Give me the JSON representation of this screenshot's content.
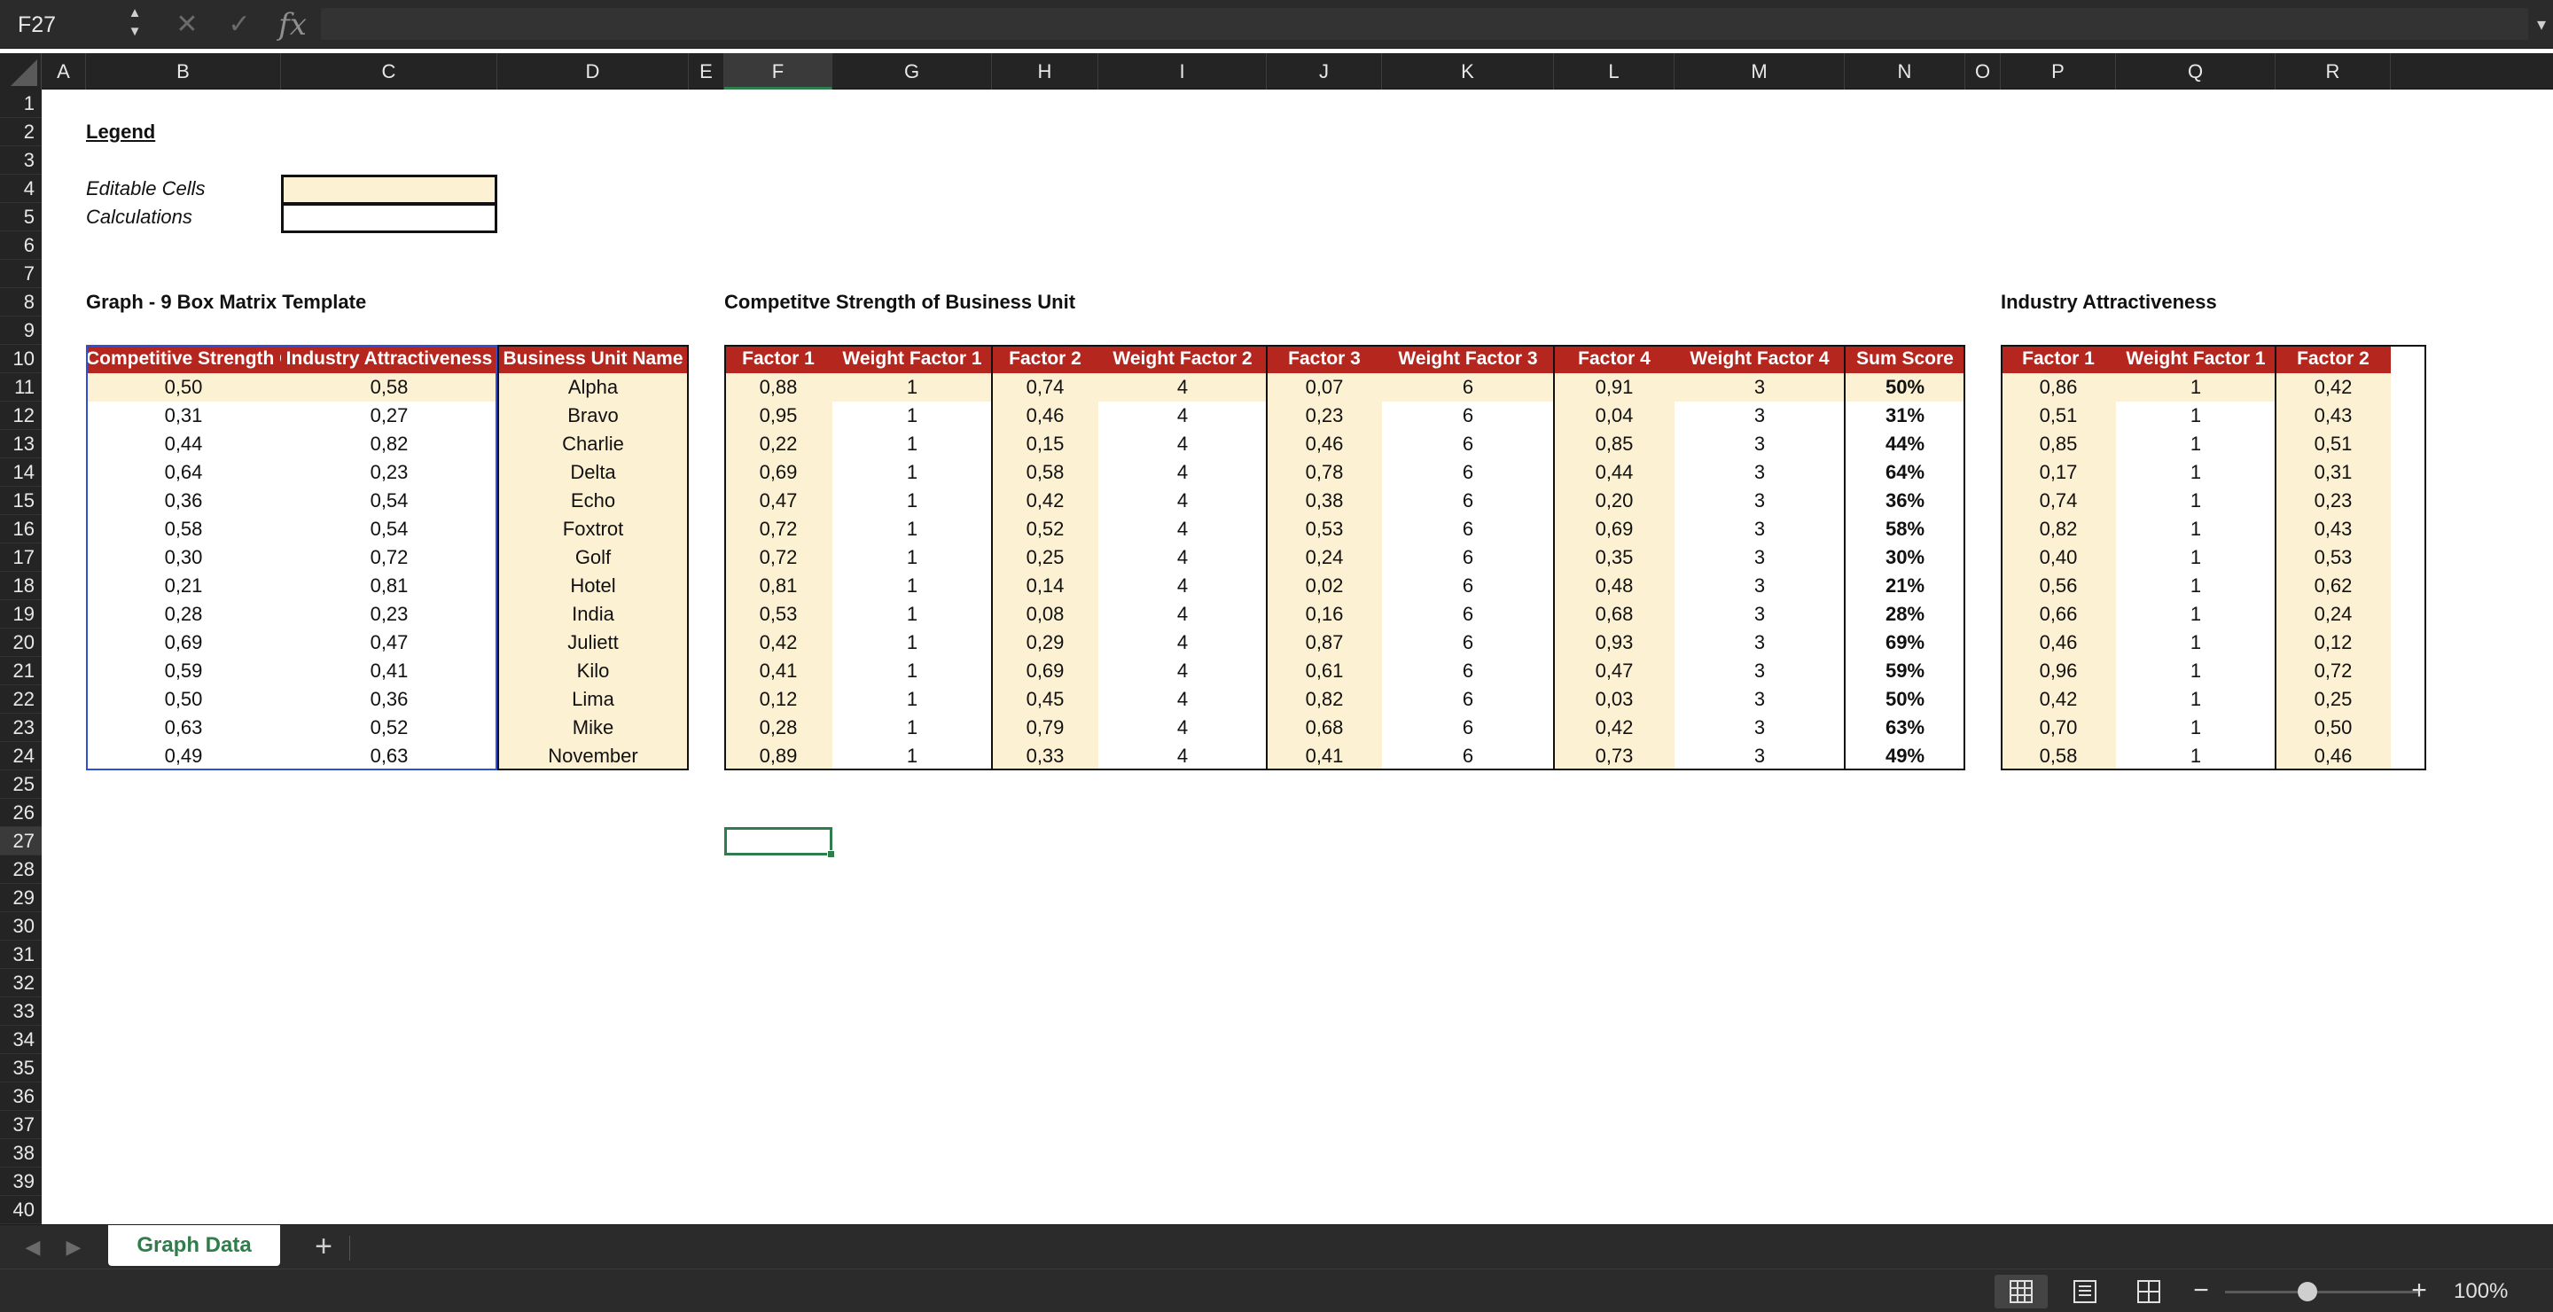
{
  "formula_bar": {
    "name_box": "F27",
    "formula": "",
    "stepper_up": "▲",
    "stepper_down": "▼",
    "cancel_glyph": "✕",
    "confirm_glyph": "✓",
    "fx_glyph": "fx",
    "expand_glyph": "▾"
  },
  "columns": [
    "A",
    "B",
    "C",
    "D",
    "E",
    "F",
    "G",
    "H",
    "I",
    "J",
    "K",
    "L",
    "M",
    "N",
    "O",
    "P",
    "Q",
    "R"
  ],
  "rows": [
    "1",
    "2",
    "3",
    "4",
    "5",
    "6",
    "7",
    "8",
    "9",
    "10",
    "11",
    "12",
    "13",
    "14",
    "15",
    "16",
    "17",
    "18",
    "19",
    "20",
    "21",
    "22",
    "23",
    "24",
    "25",
    "26",
    "27",
    "28",
    "29",
    "30",
    "31",
    "32",
    "33",
    "34",
    "35",
    "36",
    "37",
    "38",
    "39",
    "40"
  ],
  "selected_column": "F",
  "selected_row": "27",
  "legend": {
    "title": "Legend",
    "editable_label": "Editable Cells",
    "calculations_label": "Calculations",
    "editable_fill": "#fdf1d3"
  },
  "sections": {
    "graph": "Graph - 9 Box Matrix Template",
    "strength": "Competitve Strength of Business Unit",
    "industry": "Industry Attractiveness"
  },
  "graph_table": {
    "headers": [
      "Competitive Strength Of Business Unit",
      "Industry Attractiveness",
      "Business Unit Name"
    ],
    "rows": [
      [
        "0,50",
        "0,58",
        "Alpha"
      ],
      [
        "0,31",
        "0,27",
        "Bravo"
      ],
      [
        "0,44",
        "0,82",
        "Charlie"
      ],
      [
        "0,64",
        "0,23",
        "Delta"
      ],
      [
        "0,36",
        "0,54",
        "Echo"
      ],
      [
        "0,58",
        "0,54",
        "Foxtrot"
      ],
      [
        "0,30",
        "0,72",
        "Golf"
      ],
      [
        "0,21",
        "0,81",
        "Hotel"
      ],
      [
        "0,28",
        "0,23",
        "India"
      ],
      [
        "0,69",
        "0,47",
        "Juliett"
      ],
      [
        "0,59",
        "0,41",
        "Kilo"
      ],
      [
        "0,50",
        "0,36",
        "Lima"
      ],
      [
        "0,63",
        "0,52",
        "Mike"
      ],
      [
        "0,49",
        "0,63",
        "November"
      ]
    ]
  },
  "strength_table": {
    "headers": [
      "Factor 1",
      "Weight Factor 1",
      "Factor 2",
      "Weight Factor 2",
      "Factor 3",
      "Weight Factor 3",
      "Factor 4",
      "Weight Factor 4",
      "Sum Score"
    ],
    "rows": [
      [
        "0,88",
        "1",
        "0,74",
        "4",
        "0,07",
        "6",
        "0,91",
        "3",
        "50%"
      ],
      [
        "0,95",
        "1",
        "0,46",
        "4",
        "0,23",
        "6",
        "0,04",
        "3",
        "31%"
      ],
      [
        "0,22",
        "1",
        "0,15",
        "4",
        "0,46",
        "6",
        "0,85",
        "3",
        "44%"
      ],
      [
        "0,69",
        "1",
        "0,58",
        "4",
        "0,78",
        "6",
        "0,44",
        "3",
        "64%"
      ],
      [
        "0,47",
        "1",
        "0,42",
        "4",
        "0,38",
        "6",
        "0,20",
        "3",
        "36%"
      ],
      [
        "0,72",
        "1",
        "0,52",
        "4",
        "0,53",
        "6",
        "0,69",
        "3",
        "58%"
      ],
      [
        "0,72",
        "1",
        "0,25",
        "4",
        "0,24",
        "6",
        "0,35",
        "3",
        "30%"
      ],
      [
        "0,81",
        "1",
        "0,14",
        "4",
        "0,02",
        "6",
        "0,48",
        "3",
        "21%"
      ],
      [
        "0,53",
        "1",
        "0,08",
        "4",
        "0,16",
        "6",
        "0,68",
        "3",
        "28%"
      ],
      [
        "0,42",
        "1",
        "0,29",
        "4",
        "0,87",
        "6",
        "0,93",
        "3",
        "69%"
      ],
      [
        "0,41",
        "1",
        "0,69",
        "4",
        "0,61",
        "6",
        "0,47",
        "3",
        "59%"
      ],
      [
        "0,12",
        "1",
        "0,45",
        "4",
        "0,82",
        "6",
        "0,03",
        "3",
        "50%"
      ],
      [
        "0,28",
        "1",
        "0,79",
        "4",
        "0,68",
        "6",
        "0,42",
        "3",
        "63%"
      ],
      [
        "0,89",
        "1",
        "0,33",
        "4",
        "0,41",
        "6",
        "0,73",
        "3",
        "49%"
      ]
    ]
  },
  "industry_table": {
    "headers": [
      "Factor 1",
      "Weight Factor 1",
      "Factor 2"
    ],
    "rows": [
      [
        "0,86",
        "1",
        "0,42"
      ],
      [
        "0,51",
        "1",
        "0,43"
      ],
      [
        "0,85",
        "1",
        "0,51"
      ],
      [
        "0,17",
        "1",
        "0,31"
      ],
      [
        "0,74",
        "1",
        "0,23"
      ],
      [
        "0,82",
        "1",
        "0,43"
      ],
      [
        "0,40",
        "1",
        "0,53"
      ],
      [
        "0,56",
        "1",
        "0,62"
      ],
      [
        "0,66",
        "1",
        "0,24"
      ],
      [
        "0,46",
        "1",
        "0,12"
      ],
      [
        "0,96",
        "1",
        "0,72"
      ],
      [
        "0,42",
        "1",
        "0,25"
      ],
      [
        "0,70",
        "1",
        "0,50"
      ],
      [
        "0,58",
        "1",
        "0,46"
      ]
    ]
  },
  "tabs": {
    "prev_glyph": "◀",
    "next_glyph": "▶",
    "sheet_name": "Graph Data",
    "add_glyph": "+"
  },
  "status": {
    "zoom_out_glyph": "−",
    "zoom_in_glyph": "+",
    "zoom_level": "100%",
    "zoom_fraction": 0.4
  },
  "colors": {
    "header_red": "#b5271e",
    "editable_fill": "#fdf1d3",
    "selection_green": "#2f7d4a",
    "range_blue": "#2f4fd4",
    "chrome_dark": "#2b2b2b"
  }
}
